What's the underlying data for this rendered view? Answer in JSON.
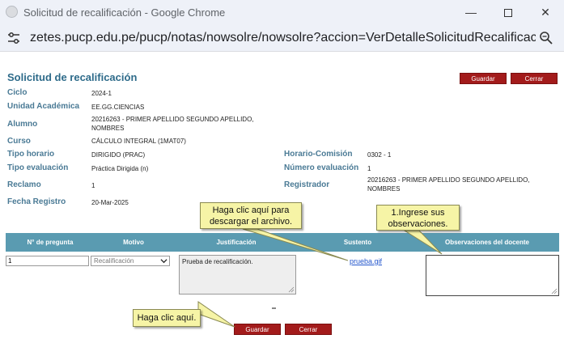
{
  "window": {
    "title": "Solicitud de recalificación - Google Chrome",
    "url": "zetes.pucp.edu.pe/pucp/notas/nowsolre/nowsolre?accion=VerDetalleSolicitudRecalificacion&acci..."
  },
  "page": {
    "title": "Solicitud de recalificación",
    "top_buttons": {
      "save": "Guardar",
      "cancel": "Cerrar"
    }
  },
  "fields": {
    "ciclo": {
      "label": "Ciclo",
      "value": "2024-1"
    },
    "unidad": {
      "label": "Unidad Académica",
      "value": "EE.GG.CIENCIAS"
    },
    "alumno": {
      "label": "Alumno",
      "value": "20216263 - PRIMER APELLIDO SEGUNDO APELLIDO, NOMBRES"
    },
    "curso": {
      "label": "Curso",
      "value": "CÁLCULO INTEGRAL (1MAT07)"
    },
    "tipo_horario": {
      "label": "Tipo horario",
      "value": "DIRIGIDO (PRAC)"
    },
    "horario_comision": {
      "label": "Horario-Comisión",
      "value": "0302 - 1"
    },
    "tipo_evaluacion": {
      "label": "Tipo evaluación",
      "value": "Práctica Dirigida (n)"
    },
    "numero_evaluacion": {
      "label": "Número evaluación",
      "value": "1"
    },
    "reclamo": {
      "label": "Reclamo",
      "value": "1"
    },
    "registrador": {
      "label": "Registrador",
      "value": "20216263 - PRIMER APELLIDO SEGUNDO APELLIDO, NOMBRES"
    },
    "fecha_registro": {
      "label": "Fecha Registro",
      "value": "20-Mar-2025"
    }
  },
  "table": {
    "headers": [
      "N° de pregunta",
      "Motivo",
      "Justificación",
      "Sustento",
      "Observaciones del docente"
    ],
    "row": {
      "question_number": "1",
      "motivo_selected": "Recalificación",
      "justificacion": "Prueba de recalificación.",
      "sustento_file": "prueba.gif",
      "observaciones": ""
    }
  },
  "bottom_buttons": {
    "save": "Guardar",
    "cancel": "Cerrar"
  },
  "callouts": {
    "download": "Haga clic aquí para descargar el archivo.",
    "observations": "1.Ingrese sus observaciones.",
    "click_here": "Haga clic aquí."
  },
  "colors": {
    "button_red": "#a31b1b",
    "table_header": "#5a9bb1",
    "label_blue": "#4a7a95",
    "callout_yellow": "#f6f4a6"
  }
}
